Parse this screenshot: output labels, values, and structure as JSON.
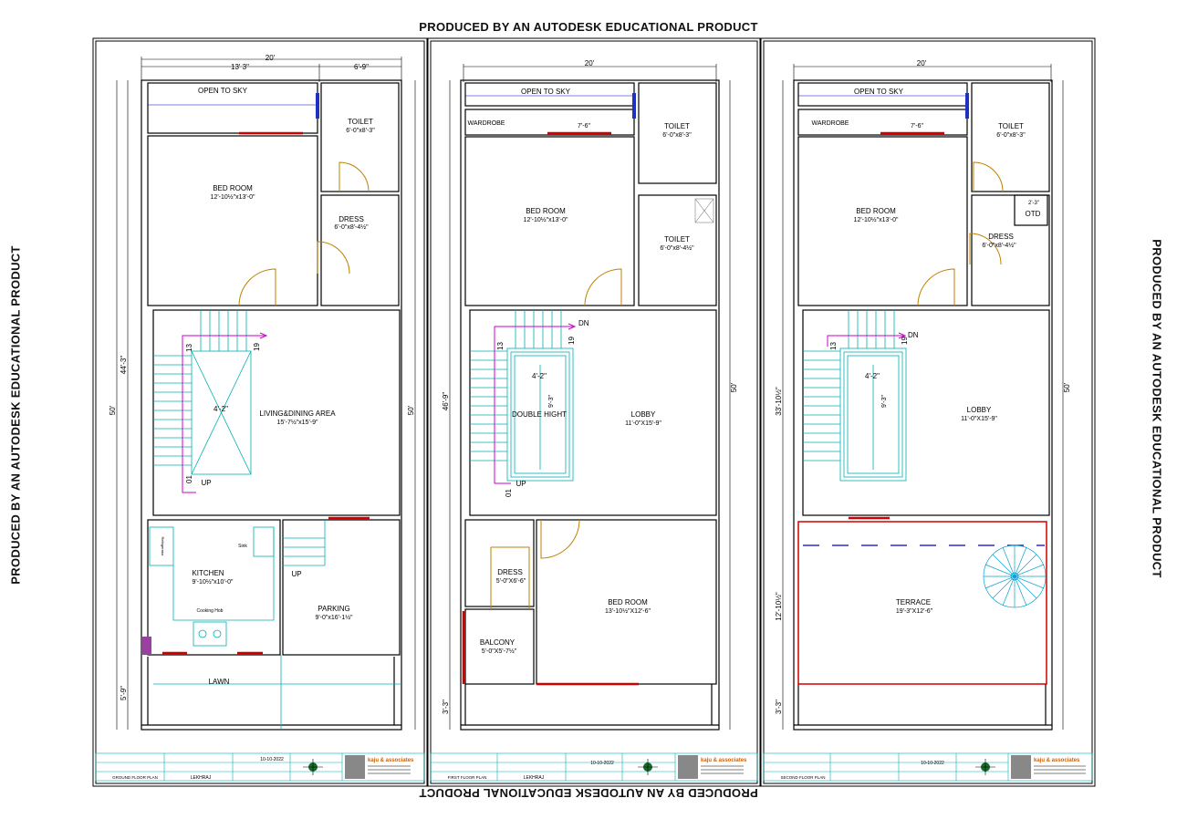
{
  "watermark": "PRODUCED BY AN AUTODESK EDUCATIONAL PRODUCT",
  "colors": {
    "wall": "#000000",
    "cyan": "#00b0b0",
    "magenta": "#cc00cc",
    "red": "#d00000",
    "orange": "#c08000",
    "blue": "#0000cc"
  },
  "sheets": [
    {
      "dims": {
        "top_total": "20'",
        "top_left": "13' 3\"",
        "top_right": "6'-9\"",
        "left_total": "50'",
        "left_inner": "44'-3\"",
        "right_total": "50'",
        "front": "5'-9\""
      },
      "rooms": {
        "open_to_sky": "OPEN TO SKY",
        "toilet": "TOILET",
        "toilet_size": "6'-0\"x8'-3\"",
        "bedroom": "BED ROOM",
        "bedroom_size": "12'-10½\"x13'-0\"",
        "dress": "DRESS",
        "dress_size": "6'-0\"x8'-4½\"",
        "living": "LIVING&DINING AREA",
        "living_size": "15'-7½\"x15'-9\"",
        "stair_a": "13",
        "stair_b": "19",
        "stair_c": "01",
        "stair_width": "4'-2\"",
        "up": "UP",
        "kitchen": "KITCHEN",
        "kitchen_size": "9'-10½\"x10'-0\"",
        "refrigerator": "Refrigerator",
        "sink": "Sink",
        "cooking_hob": "Cooking Hob",
        "parking": "PARKING",
        "parking_size": "9'-0\"x16'-1½\"",
        "parking_up": "UP",
        "lawn": "LAWN"
      },
      "title_block": {
        "date": "10-10-2022",
        "plan": "GROUND FLOOR PLAN",
        "client": "LEKHRAJ",
        "firm": "kaju & associates"
      }
    },
    {
      "dims": {
        "top_total": "20'",
        "left_total": "46'-9\"",
        "right_total": "50'",
        "front": "3'-3\"",
        "wardrobe_width": "7'-6\""
      },
      "rooms": {
        "open_to_sky": "OPEN TO SKY",
        "wardrobe": "WARDROBE",
        "toilet1": "TOILET",
        "toilet1_size": "6'-0\"x8'-3\"",
        "toilet2": "TOILET",
        "toilet2_size": "6'-0\"x8'-4½\"",
        "bedroom": "BED ROOM",
        "bedroom_size": "12'-10½\"x13'-0\"",
        "dn": "DN",
        "stair_a": "13",
        "stair_b": "19",
        "stair_c": "01",
        "stair_width": "4'-2\"",
        "stair_len": "9'-3\"",
        "double": "DOUBLE HIGHT",
        "up": "UP",
        "lobby": "LOBBY",
        "lobby_size": "11'-0\"X15'-9\"",
        "dress": "DRESS",
        "dress_size": "5'-0\"X6'-6\"",
        "bedroom2": "BED ROOM",
        "bedroom2_size": "13'-10½\"X12'-6\"",
        "balcony": "BALCONY",
        "balcony_size": "5'-0\"X5'-7½\""
      },
      "title_block": {
        "date": "10-10-2022",
        "plan": "FIRST FLOOR PLAN",
        "client": "LEKHRAJ",
        "firm": "kaju & associates"
      }
    },
    {
      "dims": {
        "top_total": "20'",
        "left_upper": "33'-10½\"",
        "left_mid": "12'-10½\"",
        "front": "3'-3\"",
        "right_total": "50'",
        "wardrobe_width": "7'-6\""
      },
      "rooms": {
        "open_to_sky": "OPEN TO SKY",
        "wardrobe": "WARDROBE",
        "toilet": "TOILET",
        "toilet_size": "6'-0\"x8'-3\"",
        "bedroom": "BED ROOM",
        "bedroom_size": "12'-10½\"x13'-0\"",
        "otd_size": "2'-3\"",
        "otd": "OTD",
        "dress": "DRESS",
        "dress_size": "6'-0\"x8'-4½\"",
        "dn": "DN",
        "stair_a": "13",
        "stair_b": "19",
        "stair_width": "4'-2\"",
        "stair_len": "9'-3\"",
        "lobby": "LOBBY",
        "lobby_size": "11'-0\"X15'-9\"",
        "terrace": "TERRACE",
        "terrace_size": "19'-3\"X12'-6\""
      },
      "title_block": {
        "date": "10-10-2022",
        "plan": "SECOND FLOOR PLAN",
        "firm": "kaju & associates"
      }
    }
  ]
}
